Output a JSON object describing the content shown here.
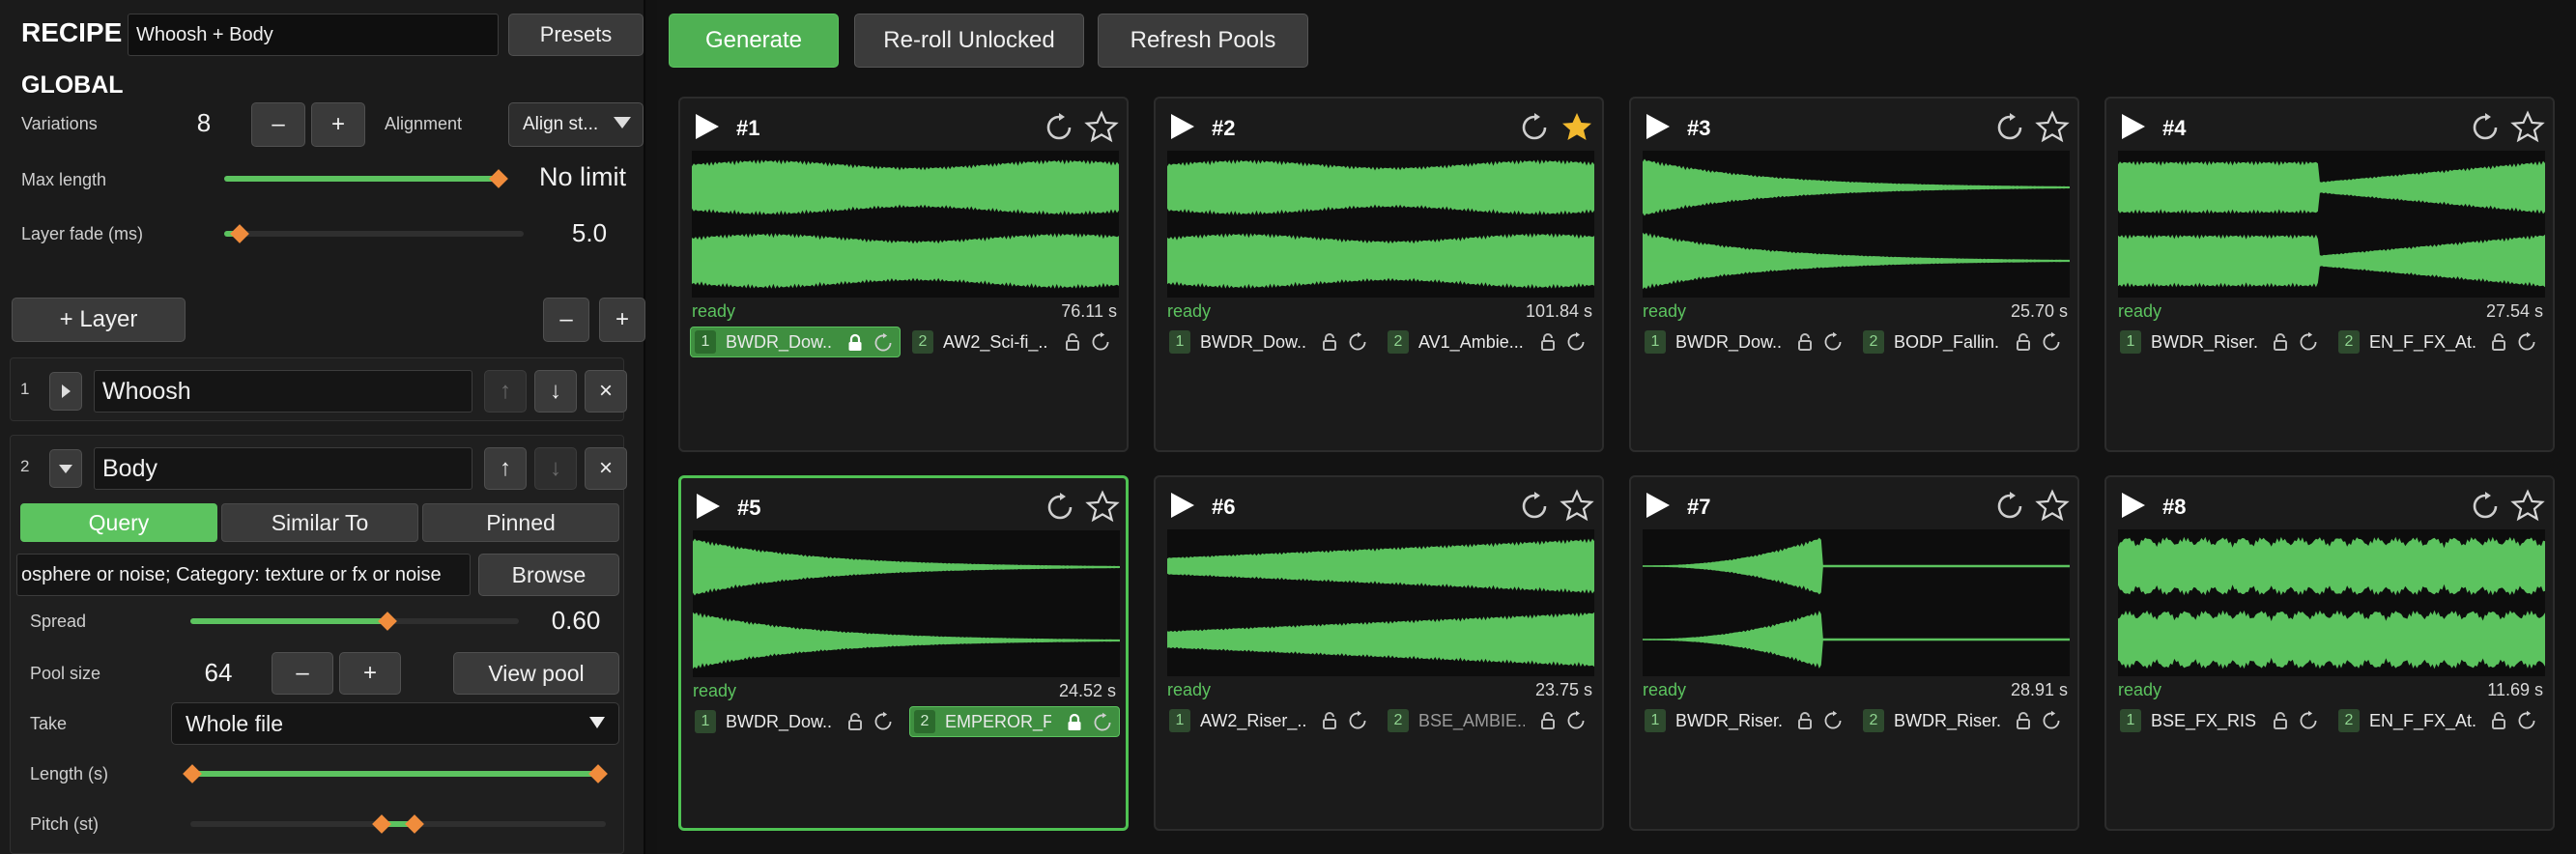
{
  "recipe": {
    "heading": "RECIPE",
    "name_value": "Whoosh + Body",
    "presets_label": "Presets"
  },
  "global": {
    "heading": "GLOBAL",
    "variations_label": "Variations",
    "variations_value": "8",
    "minus_label": "–",
    "plus_label": "+",
    "alignment_label": "Alignment",
    "alignment_value": "Align st...",
    "max_length_label": "Max length",
    "max_length_value": "No limit",
    "max_length_fraction": 1.0,
    "layer_fade_label": "Layer fade (ms)",
    "layer_fade_value": "5.0"
  },
  "layers": {
    "add_label": "+ Layer",
    "minus_label": "–",
    "plus_label": "+",
    "items": [
      {
        "index": "1",
        "name": "Whoosh",
        "up": "↑",
        "down": "↓",
        "remove": "×",
        "expanded": false
      },
      {
        "index": "2",
        "name": "Body",
        "up": "↑",
        "down": "↓",
        "remove": "×",
        "expanded": true
      }
    ]
  },
  "layer_detail": {
    "tabs": [
      {
        "label": "Query",
        "active": true
      },
      {
        "label": "Similar To",
        "active": false
      },
      {
        "label": "Pinned",
        "active": false
      }
    ],
    "query_value": "osphere or noise; Category: texture or fx or noise",
    "browse_label": "Browse",
    "spread_label": "Spread",
    "spread_value": "0.60",
    "spread_fraction": 0.6,
    "pool_size_label": "Pool size",
    "pool_size_value": "64",
    "pool_minus": "–",
    "pool_plus": "+",
    "view_pool_label": "View pool",
    "take_label": "Take",
    "take_value": "Whole file",
    "length_label": "Length (s)",
    "pitch_label": "Pitch (st)"
  },
  "toolbar": {
    "generate_label": "Generate",
    "reroll_label": "Re-roll Unlocked",
    "refresh_label": "Refresh Pools"
  },
  "colors": {
    "accent": "#5cc35f",
    "knob": "#f08c3c",
    "star_active": "#f2b92e"
  },
  "variations": [
    {
      "title": "#1",
      "status": "ready",
      "duration": "76.11 s",
      "starred": false,
      "selected": false,
      "shape": "steady",
      "chips": [
        {
          "idx": "1",
          "name": "BWDR_Dow...",
          "locked": true,
          "active": true,
          "muted": false
        },
        {
          "idx": "2",
          "name": "AW2_Sci-fi_...",
          "locked": false,
          "active": false,
          "muted": false
        }
      ]
    },
    {
      "title": "#2",
      "status": "ready",
      "duration": "101.84 s",
      "starred": true,
      "selected": false,
      "shape": "steady",
      "chips": [
        {
          "idx": "1",
          "name": "BWDR_Dow...",
          "locked": false,
          "active": false,
          "muted": false
        },
        {
          "idx": "2",
          "name": "AV1_Ambie...",
          "locked": false,
          "active": false,
          "muted": false
        }
      ]
    },
    {
      "title": "#3",
      "status": "ready",
      "duration": "25.70 s",
      "starred": false,
      "selected": false,
      "shape": "decay",
      "chips": [
        {
          "idx": "1",
          "name": "BWDR_Dow...",
          "locked": false,
          "active": false,
          "muted": false
        },
        {
          "idx": "2",
          "name": "BODP_Fallin...",
          "locked": false,
          "active": false,
          "muted": false
        }
      ]
    },
    {
      "title": "#4",
      "status": "ready",
      "duration": "27.54 s",
      "starred": false,
      "selected": false,
      "shape": "dip",
      "chips": [
        {
          "idx": "1",
          "name": "BWDR_Riser...",
          "locked": false,
          "active": false,
          "muted": false
        },
        {
          "idx": "2",
          "name": "EN_F_FX_At...",
          "locked": false,
          "active": false,
          "muted": false
        }
      ]
    },
    {
      "title": "#5",
      "status": "ready",
      "duration": "24.52 s",
      "starred": false,
      "selected": true,
      "shape": "decay",
      "chips": [
        {
          "idx": "1",
          "name": "BWDR_Dow...",
          "locked": false,
          "active": false,
          "muted": false
        },
        {
          "idx": "2",
          "name": "EMPEROR_F...",
          "locked": true,
          "active": true,
          "muted": false
        }
      ]
    },
    {
      "title": "#6",
      "status": "ready",
      "duration": "23.75 s",
      "starred": false,
      "selected": false,
      "shape": "swell",
      "chips": [
        {
          "idx": "1",
          "name": "AW2_Riser_...",
          "locked": false,
          "active": false,
          "muted": false
        },
        {
          "idx": "2",
          "name": "BSE_AMBIE...",
          "locked": false,
          "active": false,
          "muted": true
        }
      ]
    },
    {
      "title": "#7",
      "status": "ready",
      "duration": "28.91 s",
      "starred": false,
      "selected": false,
      "shape": "riser",
      "chips": [
        {
          "idx": "1",
          "name": "BWDR_Riser...",
          "locked": false,
          "active": false,
          "muted": false
        },
        {
          "idx": "2",
          "name": "BWDR_Riser...",
          "locked": false,
          "active": false,
          "muted": false
        }
      ]
    },
    {
      "title": "#8",
      "status": "ready",
      "duration": "11.69 s",
      "starred": false,
      "selected": false,
      "shape": "pulse",
      "chips": [
        {
          "idx": "1",
          "name": "BSE_FX_RISE...",
          "locked": false,
          "active": false,
          "muted": false
        },
        {
          "idx": "2",
          "name": "EN_F_FX_At...",
          "locked": false,
          "active": false,
          "muted": false
        }
      ]
    }
  ]
}
